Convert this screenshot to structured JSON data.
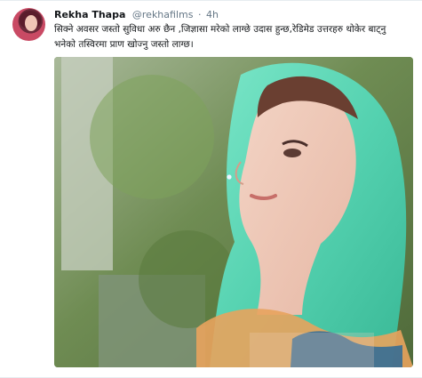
{
  "tweet": {
    "author_name": "Rekha Thapa",
    "author_handle": "@rekhafilms",
    "separator": "·",
    "timestamp": "4h",
    "text": "सिक्ने अवसर जस्तो सुविधा अरु छैन ,जिज्ञासा मरेको लाग्छे उदास हुन्छ,रेडिमेड उत्तरहरु थोकेर बाट्नु भनेको तस्विरमा प्राण खोज्नु जस्तो लाग्छ।",
    "media": {
      "type": "photo",
      "subject": "woman in green veil profile"
    }
  },
  "colors": {
    "background": "#ffffff",
    "text": "#14171a",
    "muted": "#657786",
    "veil": "#5ed6b4"
  },
  "icons": {
    "avatar": "profile-avatar"
  }
}
